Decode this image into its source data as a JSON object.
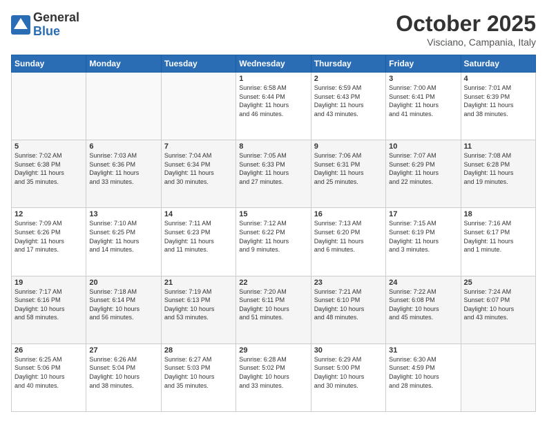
{
  "header": {
    "logo_line1": "General",
    "logo_line2": "Blue",
    "month_title": "October 2025",
    "location": "Visciano, Campania, Italy"
  },
  "weekdays": [
    "Sunday",
    "Monday",
    "Tuesday",
    "Wednesday",
    "Thursday",
    "Friday",
    "Saturday"
  ],
  "weeks": [
    [
      {
        "day": "",
        "info": ""
      },
      {
        "day": "",
        "info": ""
      },
      {
        "day": "",
        "info": ""
      },
      {
        "day": "1",
        "info": "Sunrise: 6:58 AM\nSunset: 6:44 PM\nDaylight: 11 hours\nand 46 minutes."
      },
      {
        "day": "2",
        "info": "Sunrise: 6:59 AM\nSunset: 6:43 PM\nDaylight: 11 hours\nand 43 minutes."
      },
      {
        "day": "3",
        "info": "Sunrise: 7:00 AM\nSunset: 6:41 PM\nDaylight: 11 hours\nand 41 minutes."
      },
      {
        "day": "4",
        "info": "Sunrise: 7:01 AM\nSunset: 6:39 PM\nDaylight: 11 hours\nand 38 minutes."
      }
    ],
    [
      {
        "day": "5",
        "info": "Sunrise: 7:02 AM\nSunset: 6:38 PM\nDaylight: 11 hours\nand 35 minutes."
      },
      {
        "day": "6",
        "info": "Sunrise: 7:03 AM\nSunset: 6:36 PM\nDaylight: 11 hours\nand 33 minutes."
      },
      {
        "day": "7",
        "info": "Sunrise: 7:04 AM\nSunset: 6:34 PM\nDaylight: 11 hours\nand 30 minutes."
      },
      {
        "day": "8",
        "info": "Sunrise: 7:05 AM\nSunset: 6:33 PM\nDaylight: 11 hours\nand 27 minutes."
      },
      {
        "day": "9",
        "info": "Sunrise: 7:06 AM\nSunset: 6:31 PM\nDaylight: 11 hours\nand 25 minutes."
      },
      {
        "day": "10",
        "info": "Sunrise: 7:07 AM\nSunset: 6:29 PM\nDaylight: 11 hours\nand 22 minutes."
      },
      {
        "day": "11",
        "info": "Sunrise: 7:08 AM\nSunset: 6:28 PM\nDaylight: 11 hours\nand 19 minutes."
      }
    ],
    [
      {
        "day": "12",
        "info": "Sunrise: 7:09 AM\nSunset: 6:26 PM\nDaylight: 11 hours\nand 17 minutes."
      },
      {
        "day": "13",
        "info": "Sunrise: 7:10 AM\nSunset: 6:25 PM\nDaylight: 11 hours\nand 14 minutes."
      },
      {
        "day": "14",
        "info": "Sunrise: 7:11 AM\nSunset: 6:23 PM\nDaylight: 11 hours\nand 11 minutes."
      },
      {
        "day": "15",
        "info": "Sunrise: 7:12 AM\nSunset: 6:22 PM\nDaylight: 11 hours\nand 9 minutes."
      },
      {
        "day": "16",
        "info": "Sunrise: 7:13 AM\nSunset: 6:20 PM\nDaylight: 11 hours\nand 6 minutes."
      },
      {
        "day": "17",
        "info": "Sunrise: 7:15 AM\nSunset: 6:19 PM\nDaylight: 11 hours\nand 3 minutes."
      },
      {
        "day": "18",
        "info": "Sunrise: 7:16 AM\nSunset: 6:17 PM\nDaylight: 11 hours\nand 1 minute."
      }
    ],
    [
      {
        "day": "19",
        "info": "Sunrise: 7:17 AM\nSunset: 6:16 PM\nDaylight: 10 hours\nand 58 minutes."
      },
      {
        "day": "20",
        "info": "Sunrise: 7:18 AM\nSunset: 6:14 PM\nDaylight: 10 hours\nand 56 minutes."
      },
      {
        "day": "21",
        "info": "Sunrise: 7:19 AM\nSunset: 6:13 PM\nDaylight: 10 hours\nand 53 minutes."
      },
      {
        "day": "22",
        "info": "Sunrise: 7:20 AM\nSunset: 6:11 PM\nDaylight: 10 hours\nand 51 minutes."
      },
      {
        "day": "23",
        "info": "Sunrise: 7:21 AM\nSunset: 6:10 PM\nDaylight: 10 hours\nand 48 minutes."
      },
      {
        "day": "24",
        "info": "Sunrise: 7:22 AM\nSunset: 6:08 PM\nDaylight: 10 hours\nand 45 minutes."
      },
      {
        "day": "25",
        "info": "Sunrise: 7:24 AM\nSunset: 6:07 PM\nDaylight: 10 hours\nand 43 minutes."
      }
    ],
    [
      {
        "day": "26",
        "info": "Sunrise: 6:25 AM\nSunset: 5:06 PM\nDaylight: 10 hours\nand 40 minutes."
      },
      {
        "day": "27",
        "info": "Sunrise: 6:26 AM\nSunset: 5:04 PM\nDaylight: 10 hours\nand 38 minutes."
      },
      {
        "day": "28",
        "info": "Sunrise: 6:27 AM\nSunset: 5:03 PM\nDaylight: 10 hours\nand 35 minutes."
      },
      {
        "day": "29",
        "info": "Sunrise: 6:28 AM\nSunset: 5:02 PM\nDaylight: 10 hours\nand 33 minutes."
      },
      {
        "day": "30",
        "info": "Sunrise: 6:29 AM\nSunset: 5:00 PM\nDaylight: 10 hours\nand 30 minutes."
      },
      {
        "day": "31",
        "info": "Sunrise: 6:30 AM\nSunset: 4:59 PM\nDaylight: 10 hours\nand 28 minutes."
      },
      {
        "day": "",
        "info": ""
      }
    ]
  ]
}
